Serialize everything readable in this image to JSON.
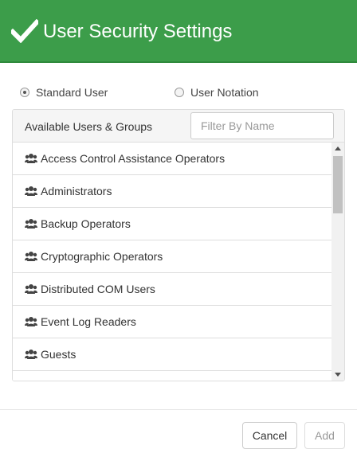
{
  "header": {
    "title": "User Security Settings",
    "icon": "checkmark-icon",
    "background_color": "#3c9d4a"
  },
  "mode": {
    "options": [
      {
        "label": "Standard User",
        "selected": true
      },
      {
        "label": "User Notation",
        "selected": false
      }
    ]
  },
  "panel": {
    "title": "Available Users & Groups",
    "filter_placeholder": "Filter By Name",
    "filter_value": ""
  },
  "groups": [
    {
      "label": "Access Control Assistance Operators",
      "icon": "users-icon"
    },
    {
      "label": "Administrators",
      "icon": "users-icon"
    },
    {
      "label": "Backup Operators",
      "icon": "users-icon"
    },
    {
      "label": "Cryptographic Operators",
      "icon": "users-icon"
    },
    {
      "label": "Distributed COM Users",
      "icon": "users-icon"
    },
    {
      "label": "Event Log Readers",
      "icon": "users-icon"
    },
    {
      "label": "Guests",
      "icon": "users-icon"
    },
    {
      "label": "",
      "icon": ""
    }
  ],
  "footer": {
    "cancel_label": "Cancel",
    "add_label": "Add",
    "add_enabled": false
  }
}
